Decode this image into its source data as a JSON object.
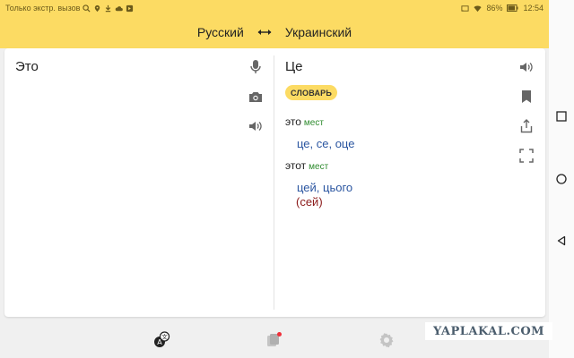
{
  "statusbar": {
    "left_text": "Только экстр. вызов",
    "battery": "86%",
    "time": "12:54"
  },
  "header": {
    "source_lang": "Русский",
    "target_lang": "Украинский"
  },
  "source": {
    "text": "Это"
  },
  "translation": {
    "main": "Це",
    "dictionary_label": "СЛОВАРЬ",
    "entries": [
      {
        "word": "это",
        "pos": "мест",
        "translations": "це, се, оце",
        "note": ""
      },
      {
        "word": "этот",
        "pos": "мест",
        "translations": "цей, цього",
        "note": "(сей)"
      }
    ]
  },
  "watermark": "YAPLAKAL.COM",
  "colors": {
    "accent": "#fcdb63",
    "translation_blue": "#2a55a0",
    "pos_green": "#2e8b2e",
    "note_red": "#8b1a1a"
  }
}
